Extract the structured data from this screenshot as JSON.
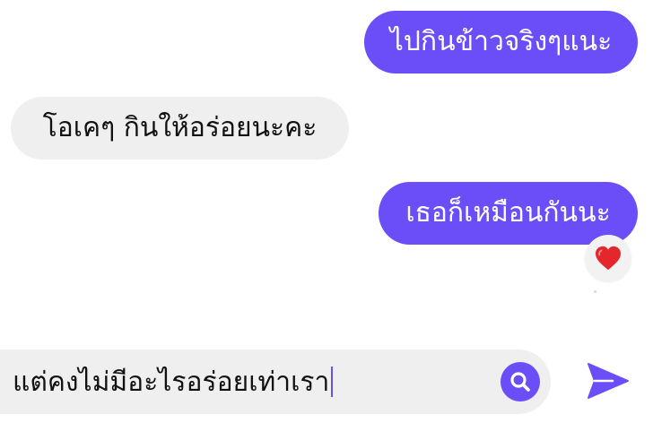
{
  "messages": [
    {
      "text": "ไปกินข้าวจริงๆแนะ",
      "sender": "me"
    },
    {
      "text": "โอเคๆ กินให้อร่อยนะคะ",
      "sender": "them"
    },
    {
      "text": "เธอก็เหมือนกันนะ",
      "sender": "me",
      "reaction": "heart"
    }
  ],
  "composer": {
    "value": "แต่คงไม่มีอะไรอร่อยเท่าเรา"
  },
  "colors": {
    "accent": "#6b4ef7",
    "received_bubble": "#efefef",
    "heart": "#e3272d"
  },
  "icons": {
    "reaction": "heart-icon",
    "search": "search-icon",
    "send": "send-icon"
  }
}
